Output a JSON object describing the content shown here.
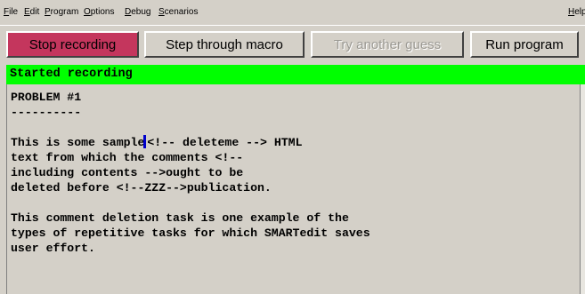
{
  "menu": {
    "items": [
      "File",
      "Edit",
      "Program",
      "Options",
      "Debug",
      "Scenarios"
    ],
    "help": "Help"
  },
  "toolbar": {
    "stop_recording": "Stop recording",
    "step_macro": "Step through macro",
    "try_guess": "Try another guess",
    "run_program": "Run program"
  },
  "status": {
    "text": "Started recording"
  },
  "editor": {
    "before_cursor": "PROBLEM #1\n----------\n\nThis is some sample",
    "after_cursor": "<!-- deleteme --> HTML\ntext from which the comments <!--\nincluding contents -->ought to be\ndeleted before <!--ZZZ-->publication.\n\nThis comment deletion task is one example of the\ntypes of repetitive tasks for which SMARTedit saves\nuser effort."
  },
  "colors": {
    "window_bg": "#d4d0c8",
    "recording_button": "#c4365d",
    "status_bar": "#00ff00",
    "cursor": "#0000cc"
  }
}
